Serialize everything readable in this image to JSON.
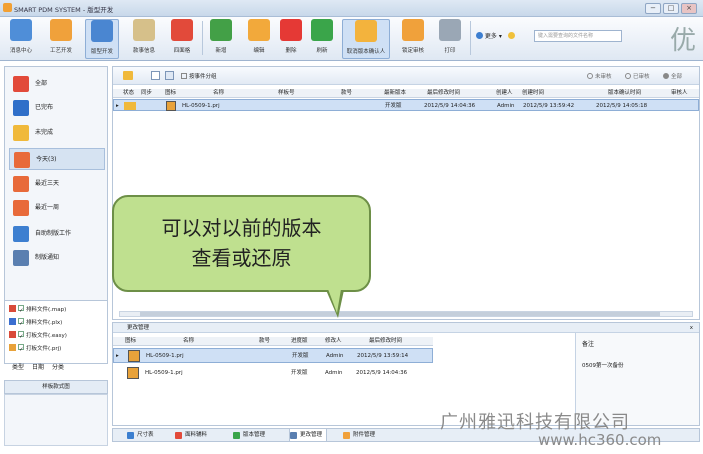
{
  "window": {
    "title": "SMART PDM SYSTEM - 版型开发",
    "minimize": "−",
    "maximize": "□",
    "close": "×"
  },
  "toolbar": {
    "buttons": [
      {
        "label": "消息中心",
        "icon": "message-center-icon",
        "color": "#4f8ed8"
      },
      {
        "label": "工艺开发",
        "icon": "process-dev-icon",
        "color": "#f0a13b"
      },
      {
        "label": "版型开发",
        "icon": "pattern-dev-icon",
        "color": "#4a86d1"
      },
      {
        "label": "款事信息",
        "icon": "style-info-icon",
        "color": "#d6c08a"
      },
      {
        "label": "四面格",
        "icon": "grid-icon",
        "color": "#e24a3a"
      },
      {
        "label": "新增",
        "icon": "add-icon",
        "color": "#43a047"
      },
      {
        "label": "编辑",
        "icon": "edit-icon",
        "color": "#f2a93b"
      },
      {
        "label": "删除",
        "icon": "delete-icon",
        "color": "#e53935"
      },
      {
        "label": "刷新",
        "icon": "refresh-icon",
        "color": "#3aa54a"
      },
      {
        "label": "取消版本确认人",
        "icon": "cancel-confirm-icon",
        "color": "#f3b33d"
      },
      {
        "label": "锁定审核",
        "icon": "lock-review-icon",
        "color": "#f0a13b"
      },
      {
        "label": "打印",
        "icon": "print-icon",
        "color": "#9aa7b5"
      }
    ],
    "more": "更多",
    "search_placeholder": "键入需要查询的文件名称"
  },
  "bigchar": "优",
  "sidebar": {
    "items": [
      {
        "label": "全部",
        "icon": "all-files-icon",
        "color": "#e24a3a"
      },
      {
        "label": "已完布",
        "icon": "published-icon",
        "color": "#2f6fc9"
      },
      {
        "label": "未完成",
        "icon": "unfinished-icon",
        "color": "#f0b93b"
      },
      {
        "label": "今天(3)",
        "icon": "calendar-today-icon",
        "color": "#e86a3a"
      },
      {
        "label": "最近三天",
        "icon": "calendar-3days-icon",
        "color": "#e86a3a"
      },
      {
        "label": "最近一周",
        "icon": "calendar-week-icon",
        "color": "#e86a3a"
      },
      {
        "label": "自助制版工作",
        "icon": "self-service-icon",
        "color": "#3d7fd0"
      },
      {
        "label": "制版通知",
        "icon": "notice-icon",
        "color": "#5a7fb0"
      }
    ],
    "types": [
      {
        "label": "排料文件(.map)",
        "color": "#d94b3a"
      },
      {
        "label": "排料文件(.plx)",
        "color": "#3b6fd0"
      },
      {
        "label": "打板文件(.easy)",
        "color": "#d94b3a"
      },
      {
        "label": "打板文件(.prj)",
        "color": "#e8a23a"
      }
    ],
    "type_tabs": [
      "类型",
      "日期",
      "分类"
    ],
    "format_label": "样板款式图"
  },
  "main": {
    "group_checkbox": "按事件分组",
    "radios": [
      "未审核",
      "已审核",
      "全部"
    ],
    "columns": [
      "状态",
      "同步",
      "图标",
      "名称",
      "样板号",
      "款号",
      "最新版本",
      "最后修改时间",
      "创建人",
      "创建时间",
      "版本确认时间",
      "审核人"
    ],
    "row": {
      "name": "HL-0509-1.prj",
      "version": "开发版",
      "modified": "2012/5/9 14:04:36",
      "creator": "Admin",
      "created": "2012/5/9 13:59:42",
      "confirm": "2012/5/9 14:05:18"
    }
  },
  "bubble": {
    "line1": "可以对以前的版本",
    "line2": "查看或还原"
  },
  "panel": {
    "title": "更改管理",
    "close": "x",
    "columns": [
      "图标",
      "名称",
      "款号",
      "进度版",
      "修改人",
      "最后修改时间"
    ],
    "rows": [
      {
        "name": "HL-0509-1.prj",
        "state": "开发版",
        "user": "Admin",
        "time": "2012/5/9 13:59:14"
      },
      {
        "name": "HL-0509-1.prj",
        "state": "开发版",
        "user": "Admin",
        "time": "2012/5/9 14:04:36"
      }
    ],
    "remark_title": "备注",
    "remark_value": "0509第一次备份"
  },
  "bottom_tabs": [
    {
      "label": "尺寸表",
      "color": "#3b7fd0"
    },
    {
      "label": "面料辅料",
      "color": "#e24a3a"
    },
    {
      "label": "版本管理",
      "color": "#3aa54a"
    },
    {
      "label": "更改管理",
      "color": "#5a7fb0"
    },
    {
      "label": "附件管理",
      "color": "#f0a13b"
    }
  ],
  "watermark": {
    "company": "广州雅迅科技有限公司",
    "website": "www.hc360.com"
  }
}
